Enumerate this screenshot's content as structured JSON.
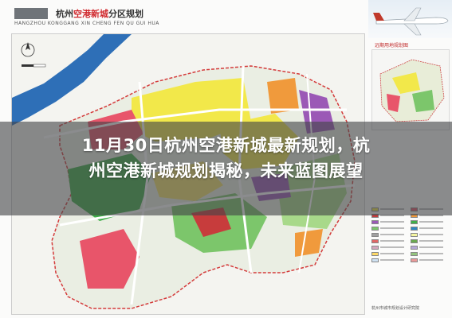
{
  "header": {
    "title_prefix": "杭州",
    "title_accent": "空港新城",
    "title_suffix": "分区规划",
    "pinyin": "HANGZHOU KONGGANG XIN CHENG FEN QU GUI HUA"
  },
  "side_panel": {
    "inset_title": "远期用地规划图"
  },
  "legend": {
    "footer": "杭州市城市规划设计研究院",
    "colors": [
      "#f2e84a",
      "#e8556a",
      "#c73c3c",
      "#f09a3c",
      "#9b59b6",
      "#3fae49",
      "#7cc66b",
      "#2e86c1",
      "#a0a0a0",
      "#f5f5a0",
      "#e06666",
      "#6aa84f",
      "#d5a6bd",
      "#b4a7d6",
      "#ffd966",
      "#93c47d",
      "#cfe2f3",
      "#ea9999"
    ]
  },
  "headline": {
    "line1": "11月30日杭州空港新城最新规划，杭",
    "line2": "州空港新城规划揭秘，未来蓝图展望"
  },
  "map_colors": {
    "residential": "#f2e84a",
    "commercial": "#e8556a",
    "commercial_dark": "#c73c3c",
    "green": "#3fae49",
    "light_green": "#a8d98a",
    "industrial": "#9b59b6",
    "orange": "#f09a3c",
    "water": "#2e6fb7",
    "road": "#ffffff"
  }
}
